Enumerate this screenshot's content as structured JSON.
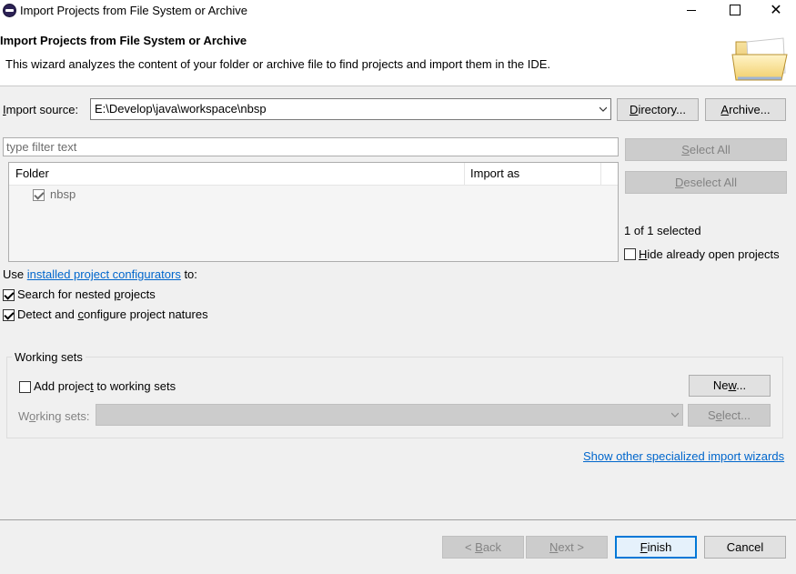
{
  "window": {
    "title": "Import Projects from File System or Archive",
    "min_glyph": "",
    "max_glyph": "",
    "close_glyph": "✕"
  },
  "header": {
    "title": "Import Projects from File System or Archive",
    "description": "This wizard analyzes the content of your folder or archive file to find projects and import them in the IDE.",
    "icon": "open-folder-icon"
  },
  "import_source": {
    "label_underlined": "I",
    "label_rest": "mport source:",
    "value": "E:\\Develop\\java\\workspace\\nbsp",
    "directory_button_u": "D",
    "directory_button_rest": "irectory...",
    "archive_button_u": "A",
    "archive_button_rest": "rchive..."
  },
  "filter": {
    "placeholder": "type filter text"
  },
  "projects_table": {
    "columns": [
      "Folder",
      "Import as"
    ],
    "rows": [
      {
        "checked": true,
        "folder": "nbsp",
        "import_as": ""
      }
    ]
  },
  "side_buttons": {
    "select_all_u": "S",
    "select_all_rest": "elect All",
    "deselect_all_u": "D",
    "deselect_all_rest": "eselect All",
    "selected_count": "1 of 1 selected",
    "hide_open_u": "H",
    "hide_open_rest": "ide already open projects",
    "hide_open_checked": false
  },
  "options": {
    "use_prefix": "Use ",
    "configurators_link": "installed project configurators",
    "use_suffix": " to:",
    "nested_pre": "Search for nested ",
    "nested_u": "p",
    "nested_post": "rojects",
    "nested_checked": true,
    "natures_pre": "Detect and ",
    "natures_u": "c",
    "natures_post": "onfigure project natures",
    "natures_checked": true
  },
  "working_sets": {
    "group_title": "Working sets",
    "add_pre": "Add projec",
    "add_u": "t",
    "add_post": " to working sets",
    "add_checked": false,
    "new_pre": "Ne",
    "new_u": "w",
    "new_post": "...",
    "sets_label_pre": "W",
    "sets_label_u": "o",
    "sets_label_post": "rking sets:",
    "sets_value": "",
    "select_pre": "S",
    "select_u": "e",
    "select_post": "lect..."
  },
  "wizards_link": "Show other specialized import wizards",
  "footer": {
    "back_pre": "< ",
    "back_u": "B",
    "back_post": "ack",
    "next_u": "N",
    "next_post": "ext >",
    "finish_u": "F",
    "finish_post": "inish",
    "cancel": "Cancel"
  },
  "colors": {
    "link": "#0066cc",
    "default_button_border": "#0078d7",
    "dialog_bg": "#f0f0f0"
  }
}
